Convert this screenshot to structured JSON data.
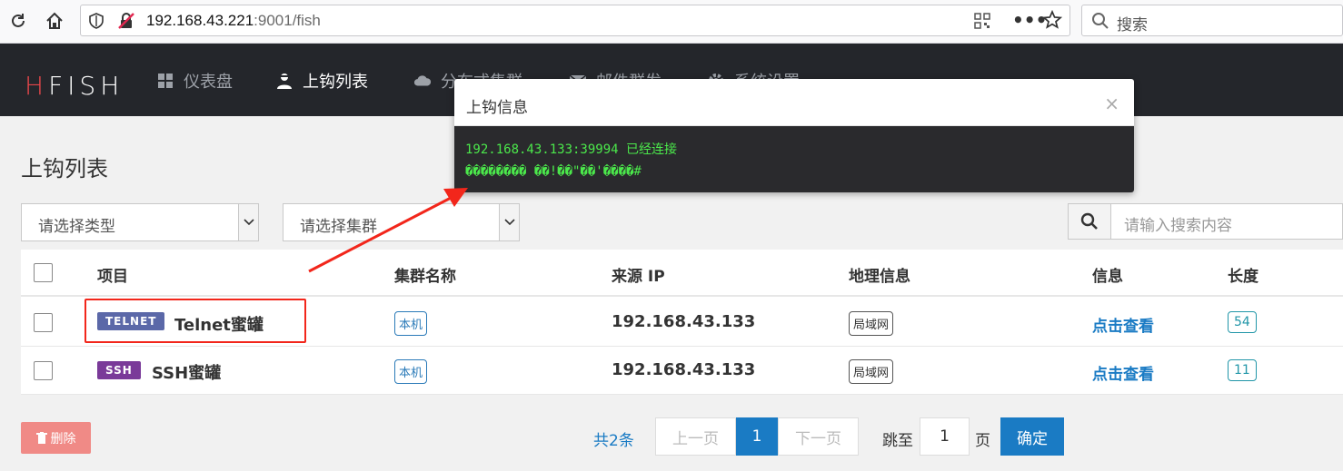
{
  "browser": {
    "url_host": "192.168.43.221",
    "url_path": ":9001/fish",
    "search_placeholder": "搜索"
  },
  "nav": {
    "logo": "HFISH",
    "items": [
      {
        "label": "仪表盘",
        "icon": "dashboard-icon"
      },
      {
        "label": "上钩列表",
        "icon": "hook-user-icon"
      },
      {
        "label": "分布式集群",
        "icon": "cloud-icon"
      },
      {
        "label": "邮件群发",
        "icon": "mail-icon"
      },
      {
        "label": "系统设置",
        "icon": "gear-icon"
      }
    ]
  },
  "page": {
    "title": "上钩列表",
    "type_select": "请选择类型",
    "cluster_select": "请选择集群",
    "search_placeholder": "请输入搜索内容"
  },
  "table": {
    "headers": [
      "项目",
      "集群名称",
      "来源 IP",
      "地理信息",
      "信息",
      "长度"
    ],
    "rows": [
      {
        "tag": "TELNET",
        "tag_color": "#5b68a8",
        "name": "Telnet蜜罐",
        "cluster": "本机",
        "ip": "192.168.43.133",
        "geo": "局域网",
        "info": "点击查看",
        "length": "54"
      },
      {
        "tag": "SSH",
        "tag_color": "#7a3a99",
        "name": "SSH蜜罐",
        "cluster": "本机",
        "ip": "192.168.43.133",
        "geo": "局域网",
        "info": "点击查看",
        "length": "11"
      }
    ]
  },
  "footer": {
    "delete_label": "删除",
    "total": "共2条",
    "prev": "上一页",
    "current_page": "1",
    "next": "下一页",
    "jump_label": "跳至",
    "jump_value": "1",
    "page_unit": "页",
    "confirm": "确定"
  },
  "modal": {
    "title": "上钩信息",
    "close": "×",
    "line1": "192.168.43.133:39994 已经连接",
    "line2": "�������� ��!��\"��'����#"
  },
  "colors": {
    "annotation": "#f2261b",
    "terminal_text": "#4be84b",
    "primary": "#1a7bc4"
  }
}
